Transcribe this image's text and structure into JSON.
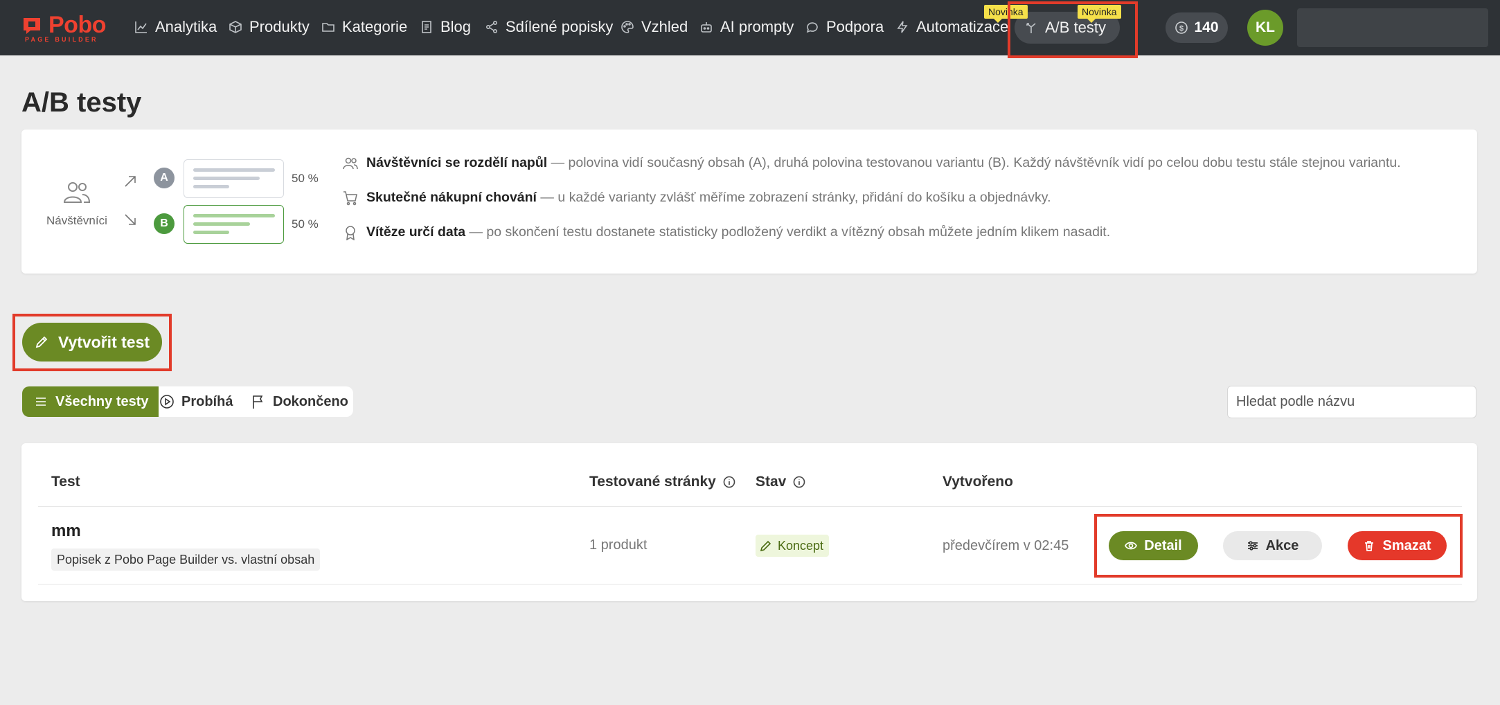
{
  "brand": {
    "name": "Pobo",
    "tagline": "PAGE BUILDER",
    "color": "#ef4130"
  },
  "nav": {
    "items": [
      {
        "label": "Analytika",
        "icon": "chart-line-icon"
      },
      {
        "label": "Produkty",
        "icon": "box-icon"
      },
      {
        "label": "Kategorie",
        "icon": "folder-icon"
      },
      {
        "label": "Blog",
        "icon": "document-icon"
      },
      {
        "label": "Sdílené popisky",
        "icon": "share-icon"
      },
      {
        "label": "Vzhled",
        "icon": "palette-icon"
      },
      {
        "label": "AI prompty",
        "icon": "robot-icon"
      },
      {
        "label": "Podpora",
        "icon": "chat-bubble-icon"
      },
      {
        "label": "Automatizace",
        "icon": "lightning-icon"
      },
      {
        "label": "A/B testy",
        "icon": "split-icon",
        "active": true
      }
    ],
    "badges": [
      "Novinka",
      "Novinka"
    ],
    "credits": "140",
    "avatar_initials": "KL"
  },
  "page": {
    "title": "A/B testy"
  },
  "info": {
    "visitors_label": "Návštěvníci",
    "variant_a": {
      "letter": "A",
      "percent": "50 %",
      "color": "#8d949e"
    },
    "variant_b": {
      "letter": "B",
      "percent": "50 %",
      "color": "#4c9a3e"
    },
    "rows": [
      {
        "title": "Návštěvníci se rozdělí napůl",
        "desc": "— polovina vidí současný obsah (A), druhá polovina testovanou variantu (B). Každý návštěvník vidí po celou dobu testu stále stejnou variantu."
      },
      {
        "title": "Skutečné nákupní chování",
        "desc": "— u každé varianty zvlášť měříme zobrazení stránky, přidání do košíku a objednávky."
      },
      {
        "title": "Vítěze určí data",
        "desc": "— po skončení testu dostanete statisticky podložený verdikt a vítězný obsah můžete jedním klikem nasadit."
      }
    ]
  },
  "actions": {
    "create_label": "Vytvořit test"
  },
  "filters": {
    "all": "Všechny testy",
    "running": "Probíhá",
    "done": "Dokončeno",
    "search_placeholder": "Hledat podle názvu"
  },
  "table": {
    "headers": {
      "test": "Test",
      "pages": "Testované stránky",
      "status": "Stav",
      "created": "Vytvořeno"
    },
    "rows": [
      {
        "name": "mm",
        "description": "Popisek z Pobo Page Builder vs. vlastní obsah",
        "pages": "1 produkt",
        "status": "Koncept",
        "created": "předevčírem v 02:45",
        "detail_label": "Detail",
        "actions_label": "Akce",
        "delete_label": "Smazat"
      }
    ]
  },
  "colors": {
    "primary": "#6b8a24",
    "danger": "#e5382a",
    "topbar": "#2e3236",
    "highlight": "#e23b2a"
  }
}
